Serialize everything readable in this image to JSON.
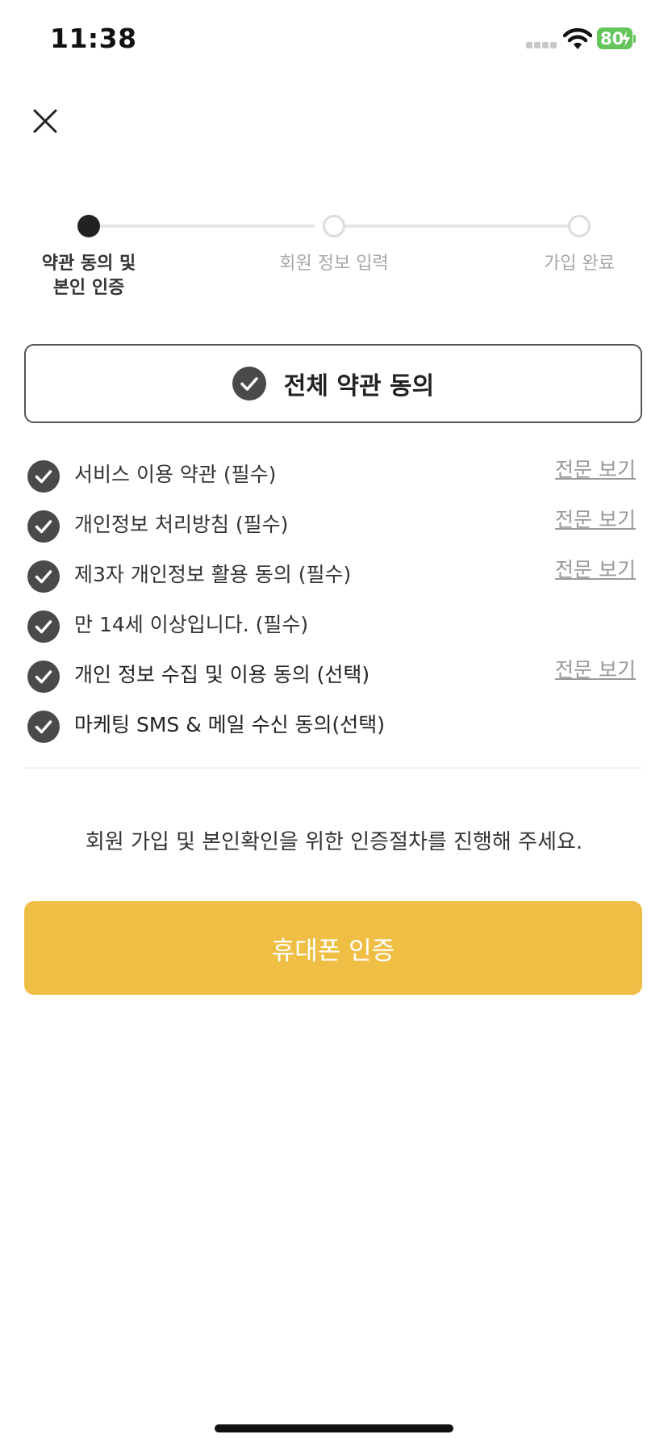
{
  "status_bar": {
    "time": "11:38",
    "battery_level": "80",
    "icons": [
      "signal-icon",
      "wifi-icon",
      "battery-charging-icon"
    ]
  },
  "header": {
    "close_icon": "close-icon"
  },
  "stepper": {
    "steps": [
      {
        "label": "약관 동의 및\n본인 인증",
        "state": "active"
      },
      {
        "label": "회원 정보 입력",
        "state": "inactive"
      },
      {
        "label": "가입 완료",
        "state": "inactive"
      }
    ]
  },
  "agree_all": {
    "label": "전체 약관 동의",
    "checked": true
  },
  "terms": [
    {
      "label": "서비스 이용 약관 (필수)",
      "link": "전문 보기",
      "checked": true
    },
    {
      "label": "개인정보 처리방침 (필수)",
      "link": "전문 보기",
      "checked": true
    },
    {
      "label": "제3자 개인정보 활용 동의 (필수)",
      "link": "전문 보기",
      "checked": true
    },
    {
      "label": "만 14세 이상입니다. (필수)",
      "link": "",
      "checked": true
    },
    {
      "label": "개인 정보 수집 및 이용 동의 (선택)",
      "link": "전문 보기",
      "checked": true
    },
    {
      "label": "마케팅 SMS & 메일 수신 동의(선택)",
      "link": "",
      "checked": true
    }
  ],
  "notice": "회원 가입 및 본인확인을 위한 인증절차를 진행해 주세요.",
  "verify_button": {
    "label": "휴대폰 인증"
  },
  "colors": {
    "accent": "#efbe45",
    "check_fill": "#4a4a4a",
    "link": "#9a9a9a",
    "battery": "#63c55a"
  }
}
